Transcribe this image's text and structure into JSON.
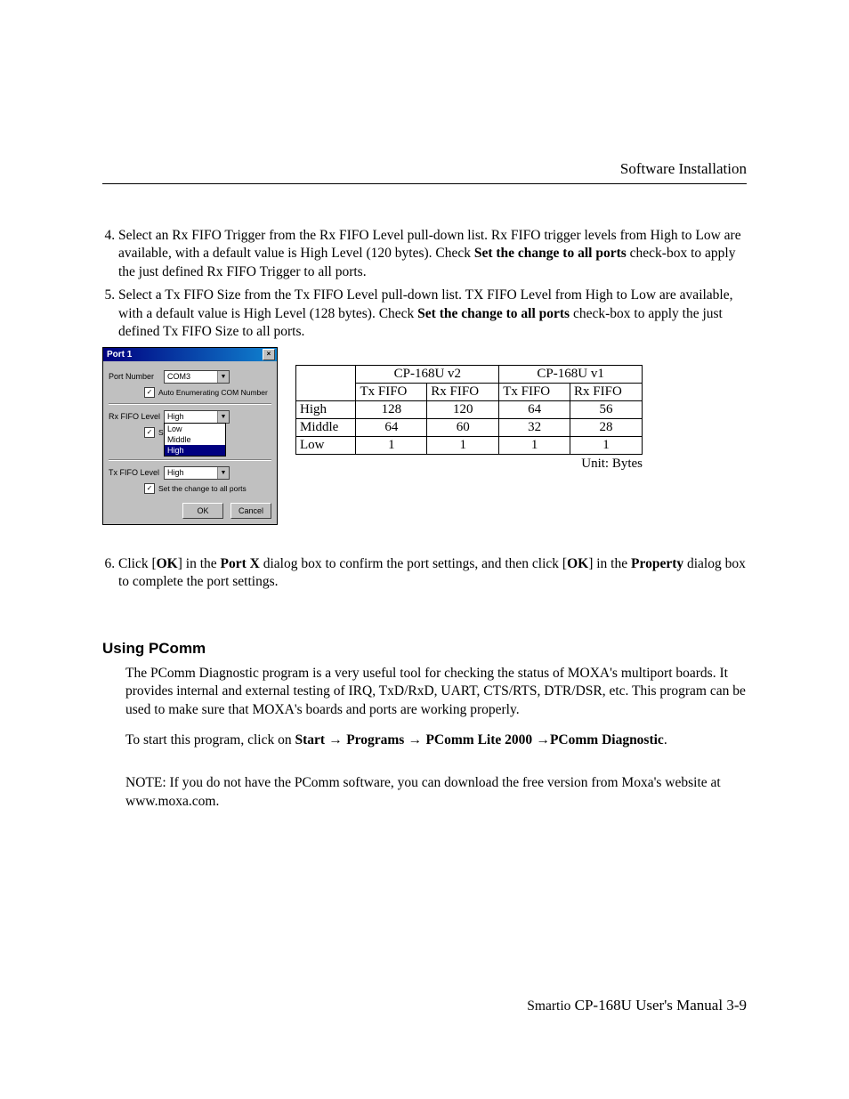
{
  "header": {
    "title": "Software Installation"
  },
  "steps": {
    "s4": {
      "num": "4.",
      "text_a": "Select an Rx FIFO Trigger from the Rx FIFO Level pull-down list. Rx FIFO trigger levels from High to Low are available, with a default value is High Level (120 bytes). Check ",
      "bold": "Set the change to all ports",
      "text_b": " check-box to apply the just defined Rx FIFO Trigger to all ports."
    },
    "s5": {
      "num": "5.",
      "text_a": "Select a Tx FIFO Size from the Tx FIFO Level pull-down list. TX FIFO Level from High to Low are available, with a default value is High Level (128 bytes).  Check ",
      "bold": "Set the change to all ports",
      "text_b": " check-box to apply the just defined Tx FIFO Size to all ports."
    },
    "s6": {
      "num": "6.",
      "a": "Click [",
      "b": "OK",
      "c": "] in the ",
      "d": "Port X",
      "e": " dialog box to confirm the port settings, and then click [",
      "f": "OK",
      "g": "] in the ",
      "h": "Property",
      "i": " dialog box to complete the port settings."
    }
  },
  "dialog": {
    "title": "Port 1",
    "close": "×",
    "port_label": "Port Number",
    "port_value": "COM3",
    "auto_enum": "Auto Enumerating COM Number",
    "rx_label": "Rx FIFO Level",
    "rx_value": "High",
    "rx_set": "Set the ch",
    "tx_label": "Tx FIFO Level",
    "tx_value": "High",
    "tx_set": "Set the change to all ports",
    "list": {
      "low": "Low",
      "middle": "Middle",
      "high": "High"
    },
    "ok": "OK",
    "cancel": "Cancel"
  },
  "chart_data": {
    "type": "table",
    "col_groups": [
      "CP-168U v2",
      "CP-168U v1"
    ],
    "sub_cols": [
      "Tx FIFO",
      "Rx FIFO",
      "Tx FIFO",
      "Rx FIFO"
    ],
    "rows": [
      {
        "label": "High",
        "values": [
          128,
          120,
          64,
          56
        ]
      },
      {
        "label": "Middle",
        "values": [
          64,
          60,
          32,
          28
        ]
      },
      {
        "label": "Low",
        "values": [
          1,
          1,
          1,
          1
        ]
      }
    ],
    "unit": "Unit: Bytes"
  },
  "section": {
    "heading": "Using PComm",
    "p1": "The PComm Diagnostic program is a very useful tool for checking the status of MOXA's multiport boards. It provides internal and external testing of IRQ, TxD/RxD, UART, CTS/RTS, DTR/DSR, etc. This program can be used to make sure that MOXA's boards and ports are working properly.",
    "p2a": "To start this program, click on ",
    "p2b": "Start",
    "p2c": "Programs",
    "p2d": "PComm Lite 2000",
    "p2e": "PComm Diagnostic",
    "p2dot": ".",
    "note": "NOTE: If you do not have the PComm software, you can download the free version from Moxa's website at www.moxa.com."
  },
  "footer": {
    "smartio": "Smartio",
    "rest": " CP-168U User's Manual    3-9"
  }
}
